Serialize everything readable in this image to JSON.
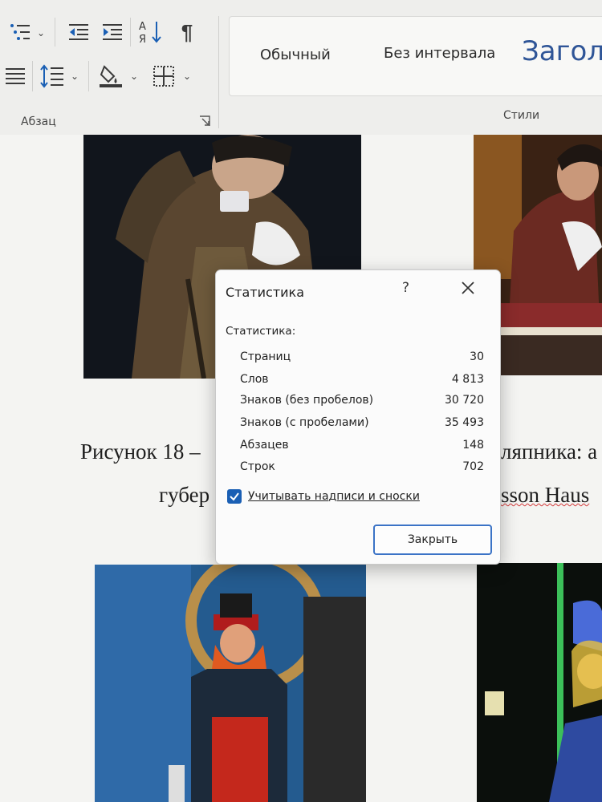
{
  "ribbon": {
    "group_paragraph_label": "Абзац",
    "group_styles_label": "Стили",
    "styles": [
      "Обычный",
      "Без интервала",
      "Загол"
    ],
    "icons": [
      "multilevel-list-icon",
      "decrease-indent-icon",
      "increase-indent-icon",
      "sort-icon",
      "pilcrow-icon",
      "justify-icon",
      "line-spacing-icon",
      "shading-icon",
      "borders-icon"
    ]
  },
  "document": {
    "caption_line1_left": "Рисунок 18 –",
    "caption_line1_right": "ляпника: а",
    "caption_line2_left": "губер",
    "caption_line2_right": "sson Haus"
  },
  "dialog": {
    "title": "Статистика",
    "help": "?",
    "section_label": "Статистика:",
    "stats": [
      {
        "label": "Страниц",
        "value": "30"
      },
      {
        "label": "Слов",
        "value": "4 813"
      },
      {
        "label": "Знаков (без пробелов)",
        "value": "30 720"
      },
      {
        "label": "Знаков (с пробелами)",
        "value": "35 493"
      },
      {
        "label": "Абзацев",
        "value": "148"
      },
      {
        "label": "Строк",
        "value": "702"
      }
    ],
    "checkbox_label": "Учитывать надписи и сноски",
    "checkbox_checked": true,
    "close_button": "Закрыть"
  },
  "colors": {
    "accent": "#1a5fb4",
    "heading_style": "#2f5597",
    "spellcheck": "#d43a3a"
  }
}
